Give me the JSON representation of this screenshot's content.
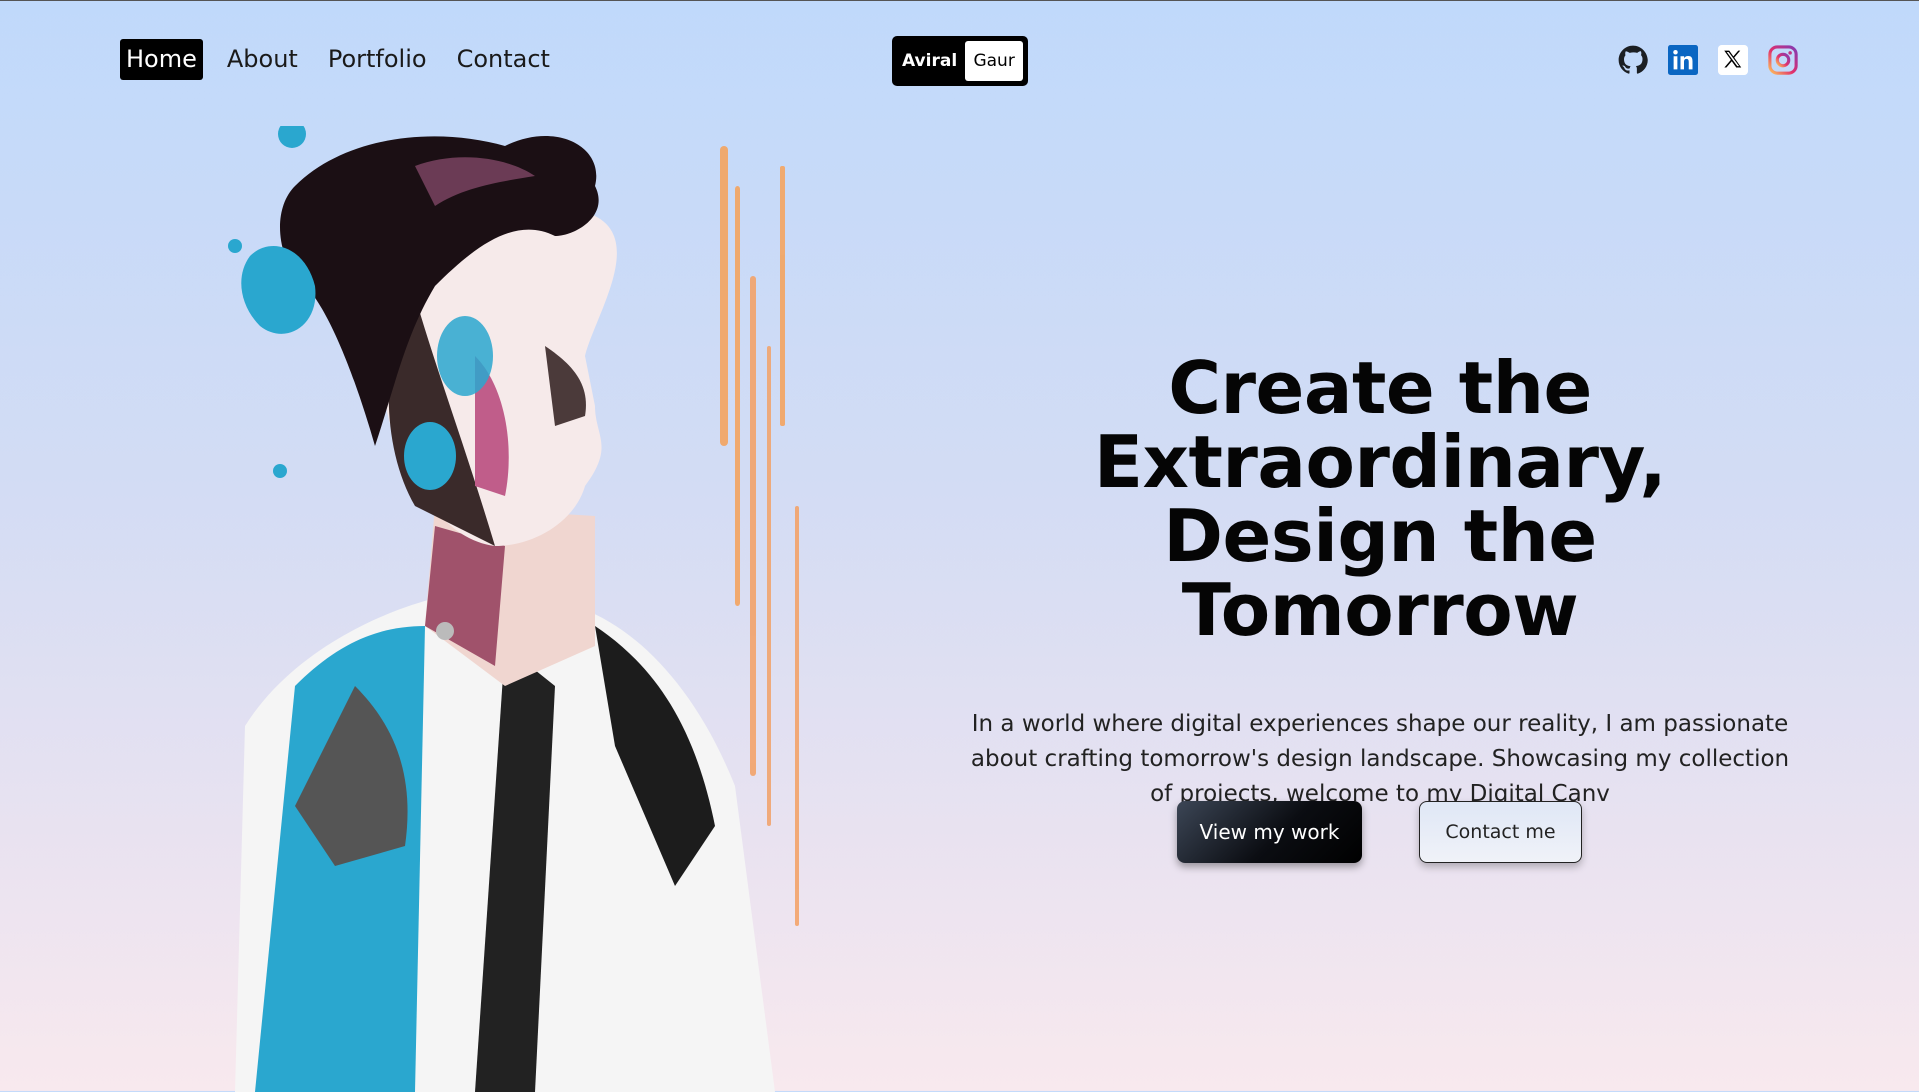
{
  "nav": {
    "items": [
      {
        "label": "Home",
        "active": true
      },
      {
        "label": "About"
      },
      {
        "label": "Portfolio"
      },
      {
        "label": "Contact"
      }
    ]
  },
  "logo": {
    "first": "Aviral",
    "last": "Gaur"
  },
  "social": [
    {
      "icon": "github-icon"
    },
    {
      "icon": "linkedin-icon",
      "color": "#0a66c2"
    },
    {
      "icon": "x-icon"
    },
    {
      "icon": "instagram-icon",
      "color": "#e1306c"
    }
  ],
  "hero": {
    "title_line1": "Create the",
    "title_line2": "Extraordinary,",
    "title_line3": "Design the Tomorrow",
    "description": "In a world where digital experiences shape our reality, I am passionate about crafting tomorrow's design landscape. Showcasing my collection of projects, welcome to my Digital Canv",
    "primary_button": "View my work",
    "secondary_button": "Contact me"
  },
  "colors": {
    "accent": "#000000",
    "background_top": "#c0d9fb",
    "background_bottom": "#f8e9ee"
  }
}
